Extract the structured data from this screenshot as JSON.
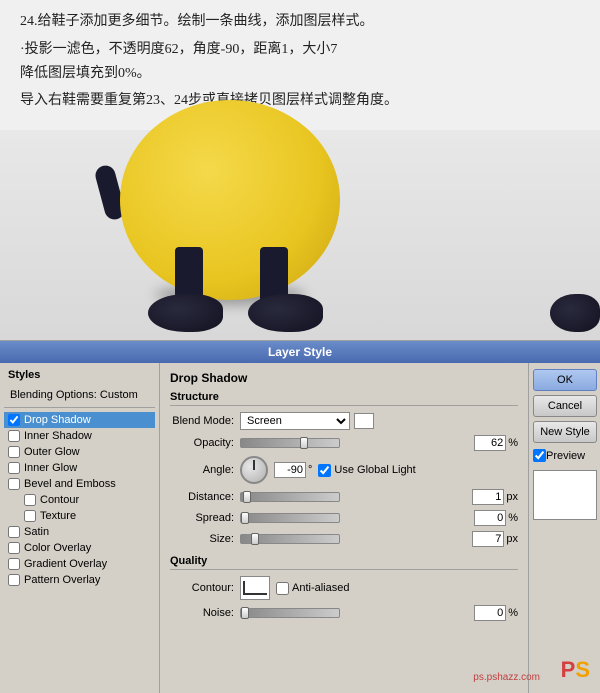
{
  "imageArea": {
    "tutorialText": {
      "line1": "24.给鞋子添加更多细节。绘制一条曲线，添加图层样式。",
      "line2": "·投影一滤色，不透明度62，角度-90，距离1，大小7",
      "line3": "降低图层填充到0%。",
      "line4": "导入右鞋需要重复第23、24步或直接拷贝图层样式调整角度。"
    }
  },
  "dialog": {
    "title": "Layer Style",
    "stylesPanel": {
      "title": "Styles",
      "blendingOptions": "Blending Options: Custom",
      "items": [
        {
          "label": "Drop Shadow",
          "checked": true,
          "selected": true,
          "indent": false
        },
        {
          "label": "Inner Shadow",
          "checked": false,
          "selected": false,
          "indent": false
        },
        {
          "label": "Outer Glow",
          "checked": false,
          "selected": false,
          "indent": false
        },
        {
          "label": "Inner Glow",
          "checked": false,
          "selected": false,
          "indent": false
        },
        {
          "label": "Bevel and Emboss",
          "checked": false,
          "selected": false,
          "indent": false
        },
        {
          "label": "Contour",
          "checked": false,
          "selected": false,
          "indent": true
        },
        {
          "label": "Texture",
          "checked": false,
          "selected": false,
          "indent": true
        },
        {
          "label": "Satin",
          "checked": false,
          "selected": false,
          "indent": false
        },
        {
          "label": "Color Overlay",
          "checked": false,
          "selected": false,
          "indent": false
        },
        {
          "label": "Gradient Overlay",
          "checked": false,
          "selected": false,
          "indent": false
        },
        {
          "label": "Pattern Overlay",
          "checked": false,
          "selected": false,
          "indent": false
        }
      ]
    },
    "optionsPanel": {
      "sectionTitle": "Drop Shadow",
      "structureTitle": "Structure",
      "blendMode": {
        "label": "Blend Mode:",
        "value": "Screen"
      },
      "opacity": {
        "label": "Opacity:",
        "value": "62",
        "unit": "%"
      },
      "angle": {
        "label": "Angle:",
        "value": "-90",
        "unit": "°",
        "useGlobalLight": "Use Global Light",
        "checked": true
      },
      "distance": {
        "label": "Distance:",
        "value": "1",
        "unit": "px"
      },
      "spread": {
        "label": "Spread:",
        "value": "0",
        "unit": "%"
      },
      "size": {
        "label": "Size:",
        "value": "7",
        "unit": "px"
      },
      "qualityTitle": "Quality",
      "contour": {
        "label": "Contour:",
        "antiAliased": "Anti-aliased"
      },
      "noise": {
        "label": "Noise:",
        "value": "0",
        "unit": "%"
      }
    },
    "buttons": {
      "ok": "OK",
      "cancel": "Cancel",
      "newStyle": "New Style",
      "preview": "Preview"
    }
  },
  "watermark": {
    "ps": "PS",
    "site": "ps.pshazz.com"
  }
}
